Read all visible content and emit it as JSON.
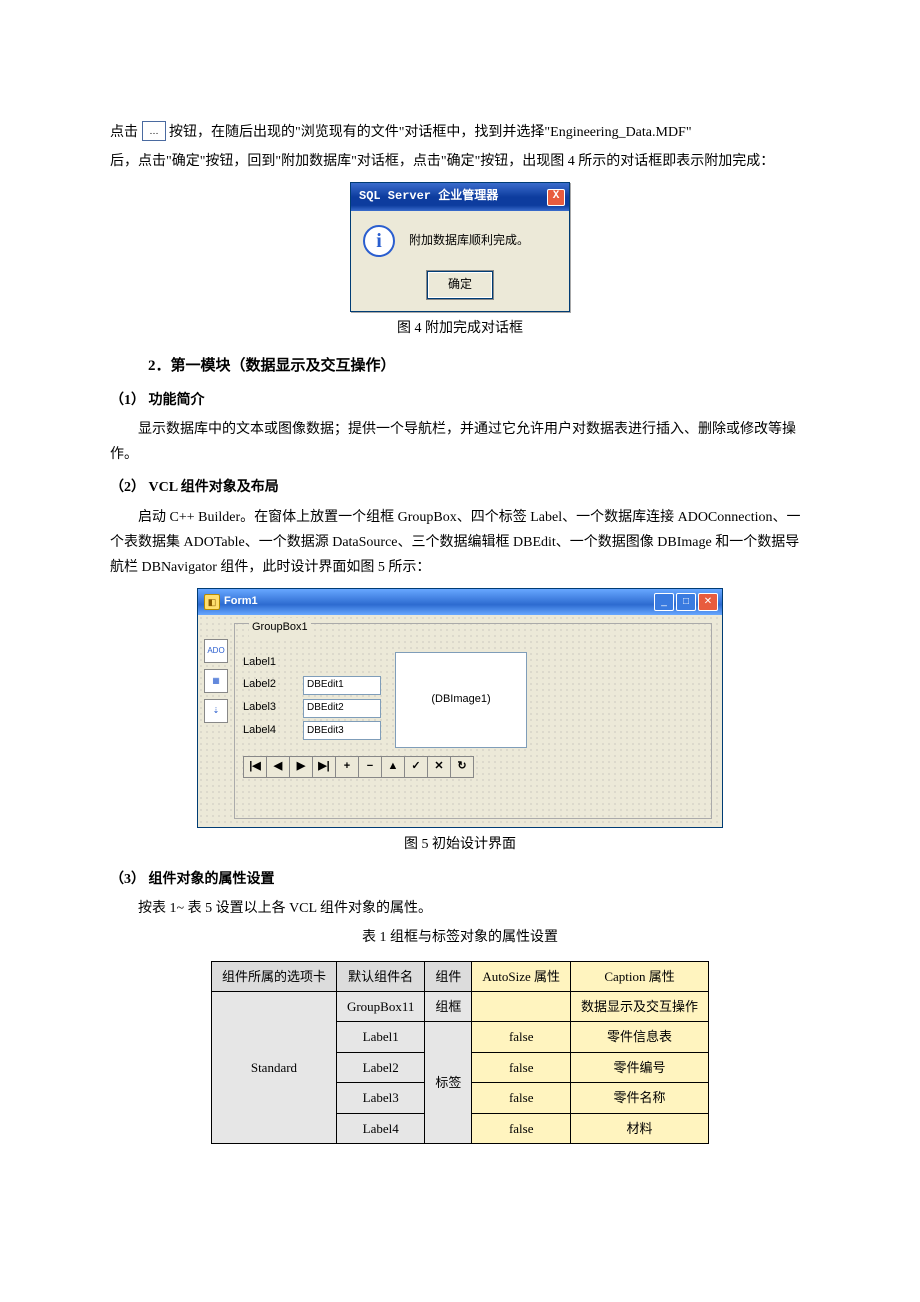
{
  "intro": {
    "line1a": "点击",
    "line1b": "按钮，在随后出现的\"浏览现有的文件\"对话框中，找到并选择\"Engineering_Data.MDF\"",
    "line2": "后，点击\"确定\"按钮，回到\"附加数据库\"对话框，点击\"确定\"按钮，出现图 4 所示的对话框即表示附加完成："
  },
  "dialog": {
    "title": "SQL Server 企业管理器",
    "close": "X",
    "message": "附加数据库顺利完成。",
    "ok": "确定"
  },
  "figure4": "图 4   附加完成对话框",
  "section2": "2．第一模块（数据显示及交互操作）",
  "sub1_title": "（1）  功能简介",
  "sub1_body": "显示数据库中的文本或图像数据；提供一个导航栏，并通过它允许用户对数据表进行插入、删除或修改等操作。",
  "sub2_title": "（2）  VCL 组件对象及布局",
  "sub2_body": "启动 C++ Builder。在窗体上放置一个组框 GroupBox、四个标签 Label、一个数据库连接 ADOConnection、一个表数据集 ADOTable、一个数据源 DataSource、三个数据编辑框 DBEdit、一个数据图像 DBImage 和一个数据导航栏 DBNavigator 组件，此时设计界面如图 5 所示：",
  "form1": {
    "title": "Form1",
    "groupbox": "GroupBox1",
    "labels": [
      "Label1",
      "Label2",
      "Label3",
      "Label4"
    ],
    "edits": [
      "DBEdit1",
      "DBEdit2",
      "DBEdit3"
    ],
    "dbimage": "(DBImage1)",
    "nav": [
      "|◀",
      "◀",
      "▶",
      "▶|",
      "+",
      "−",
      "▲",
      "✓",
      "✕",
      "↻"
    ]
  },
  "figure5": "图 5   初始设计界面",
  "sub3_title": "（3）  组件对象的属性设置",
  "sub3_body": "按表 1~ 表 5 设置以上各 VCL 组件对象的属性。",
  "table1_caption": "表 1   组框与标签对象的属性设置",
  "table1": {
    "headers": [
      "组件所属的选项卡",
      "默认组件名",
      "组件",
      "AutoSize 属性",
      "Caption 属性"
    ],
    "col1": "Standard",
    "rows": [
      {
        "name": "GroupBox11",
        "comp": "组框",
        "auto": "",
        "caption": "数据显示及交互操作"
      },
      {
        "name": "Label1",
        "comp": "标签",
        "auto": "false",
        "caption": "零件信息表"
      },
      {
        "name": "Label2",
        "comp": "",
        "auto": "false",
        "caption": "零件编号"
      },
      {
        "name": "Label3",
        "comp": "",
        "auto": "false",
        "caption": "零件名称"
      },
      {
        "name": "Label4",
        "comp": "",
        "auto": "false",
        "caption": "材料"
      }
    ]
  }
}
